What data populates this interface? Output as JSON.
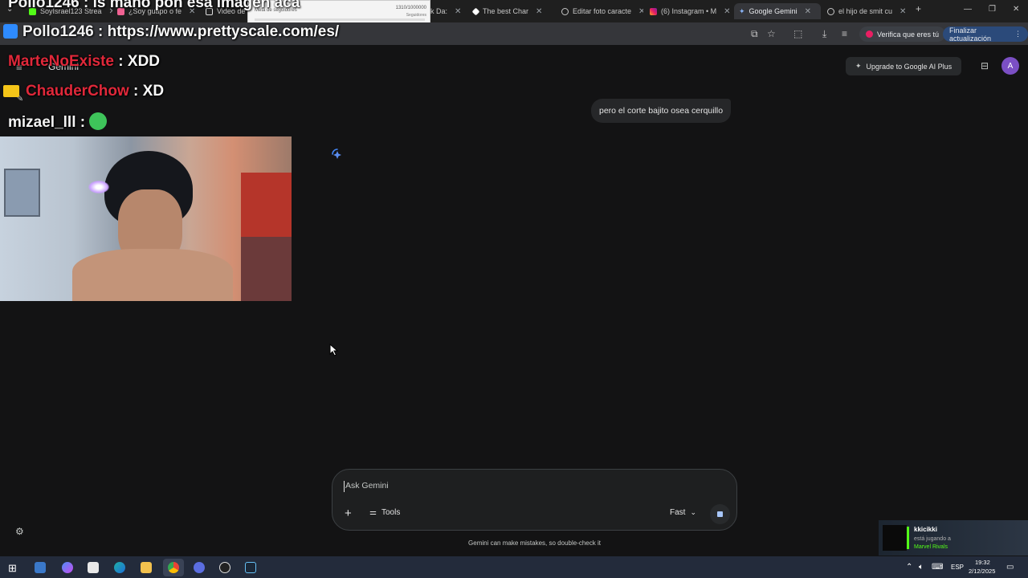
{
  "browser": {
    "tabs": [
      {
        "label": "SoyIsrael123 Strea",
        "active": false
      },
      {
        "label": "¿Soy guapo o fe",
        "active": false
      },
      {
        "label": "Video de",
        "active": false
      },
      {
        "label": "k Da:",
        "active": false
      },
      {
        "label": "The best Char",
        "active": false
      },
      {
        "label": "Editar foto caracte",
        "active": false
      },
      {
        "label": "(6) Instagram • M",
        "active": false
      },
      {
        "label": "Google Gemini",
        "active": true
      },
      {
        "label": "el hijo de smit cu",
        "active": false
      }
    ],
    "new_tab": "+",
    "verify_label": "Verifica que eres tú",
    "update_label": "Finalizar actualización",
    "popup_count": "1310/1000000",
    "popup_subtitle": "Seguidores",
    "popup_label": "Meta de seguidores"
  },
  "overlay": {
    "chat": [
      {
        "user": "Pollo1246",
        "sep": " : ",
        "msg": "is mano pon esa imagen aca",
        "color": "white"
      },
      {
        "user": "Pollo1246",
        "sep": " : ",
        "msg": "https://www.prettyscale.com/es/",
        "color": "white"
      },
      {
        "user": "MarteNoExiste",
        "sep": " : ",
        "msg": "XDD",
        "color": "red"
      },
      {
        "user": "ChauderChow",
        "sep": " : ",
        "msg": "XD",
        "color": "red"
      },
      {
        "user": "mizael_lll",
        "sep": " : ",
        "msg": "",
        "color": "white"
      }
    ],
    "activity": {
      "user": "kkicikki",
      "status": "está jugando a",
      "game": "Marvel Rivals"
    }
  },
  "gemini": {
    "app_title": "Gemini",
    "upgrade_label": "Upgrade to Google AI Plus",
    "avatar_letter": "A",
    "user_message": "pero el corte bajito osea cerquillo",
    "input_placeholder": "Ask Gemini",
    "tools_label": "Tools",
    "mode_label": "Fast",
    "disclaimer": "Gemini can make mistakes, so double-check it"
  },
  "taskbar": {
    "language": "ESP",
    "time": "19:32",
    "date": "2/12/2025"
  },
  "colors": {
    "background": "#131314",
    "accent": "#4285f4",
    "chat_red": "#e0283a",
    "avatar": "#7b4fc4"
  }
}
